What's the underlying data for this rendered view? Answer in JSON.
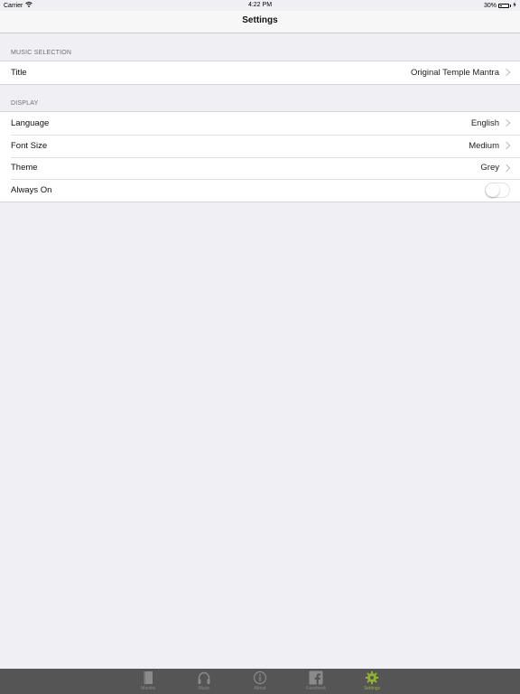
{
  "status_bar": {
    "carrier": "Carrier",
    "time": "4:22 PM",
    "battery": "30%",
    "battery_level": 0.3
  },
  "nav": {
    "title": "Settings"
  },
  "sections": {
    "music": {
      "header": "MUSIC SELECTION",
      "title_label": "Title",
      "title_value": "Original Temple Mantra"
    },
    "display": {
      "header": "DISPLAY",
      "language_label": "Language",
      "language_value": "English",
      "font_size_label": "Font Size",
      "font_size_value": "Medium",
      "theme_label": "Theme",
      "theme_value": "Grey",
      "always_on_label": "Always On",
      "always_on_state": false
    }
  },
  "tab_bar": {
    "tabs": [
      {
        "label": "Mantra",
        "icon": "book-icon"
      },
      {
        "label": "Music",
        "icon": "headphones-icon"
      },
      {
        "label": "About",
        "icon": "info-icon"
      },
      {
        "label": "Facebook",
        "icon": "facebook-icon"
      },
      {
        "label": "Settings",
        "icon": "gear-icon"
      }
    ],
    "active_index": 4,
    "active_color": "#8fb22f",
    "inactive_color": "#8a8a8a",
    "background": "#555555"
  }
}
